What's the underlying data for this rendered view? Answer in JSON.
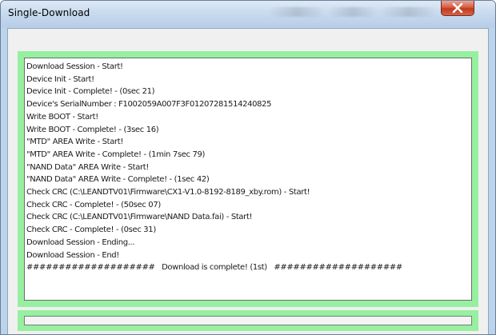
{
  "window": {
    "title": "Single-Download",
    "close_icon": "close-x-icon",
    "close_color": "#c3391d"
  },
  "log": {
    "lines": [
      "Download Session - Start!",
      "Device Init - Start!",
      "Device Init - Complete! - (0sec 21)",
      "Device's SerialNumber : F1002059A007F3F01207281514240825",
      "Write BOOT - Start!",
      "Write BOOT - Complete! - (3sec 16)",
      "\"MTD\" AREA Write - Start!",
      "\"MTD\" AREA Write - Complete! - (1min 7sec 79)",
      "\"NAND Data\" AREA Write - Start!",
      "\"NAND Data\" AREA Write - Complete! - (1sec 42)",
      "Check CRC (C:\\LEANDTV01\\Firmware\\CX1-V1.0-8192-8189_xby.rom) - Start!",
      "Check CRC - Complete! - (50sec 07)",
      "Check CRC (C:\\LEANDTV01\\Firmware\\NAND Data.fai) - Start!",
      "Check CRC - Complete! - (0sec 31)",
      "Download Session - Ending...",
      "Download Session - End!",
      "####################   Download is complete! (1st)   ####################"
    ],
    "frame_color": "#96f0a0"
  },
  "status": {
    "text": ""
  }
}
